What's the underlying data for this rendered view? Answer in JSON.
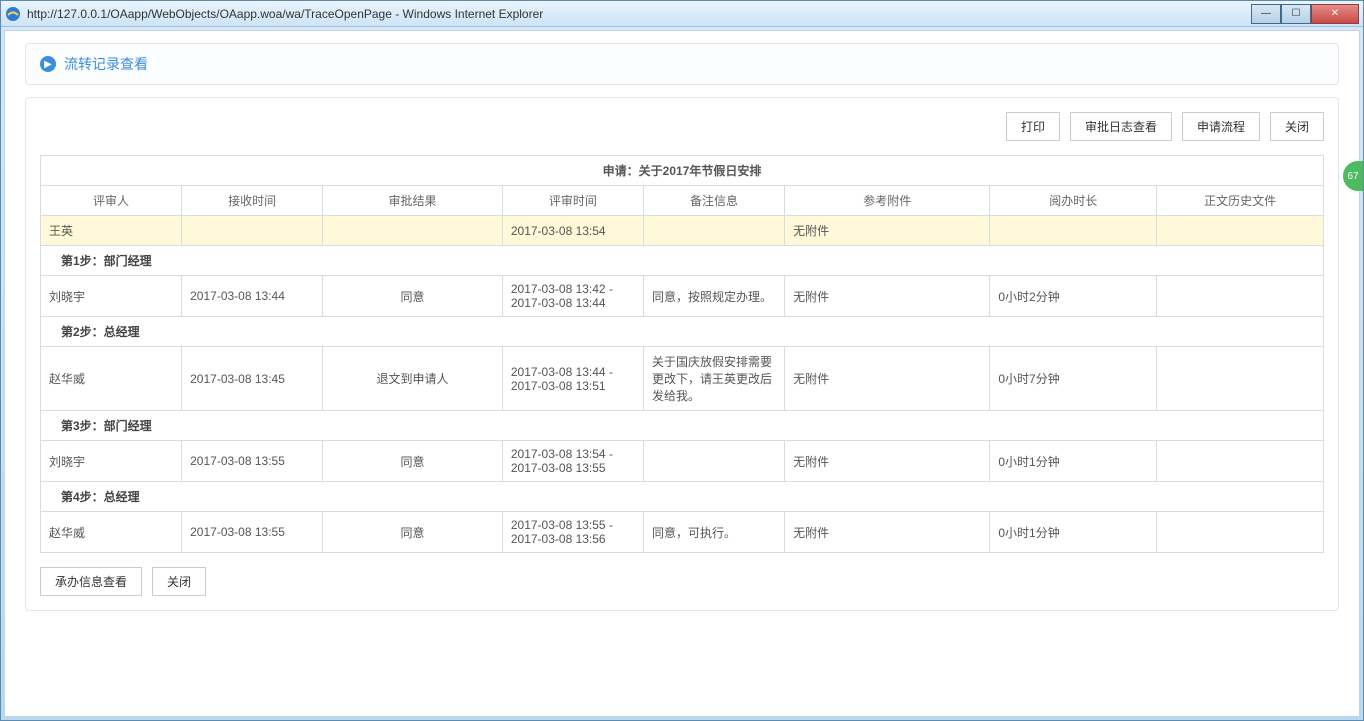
{
  "window": {
    "title": "http://127.0.0.1/OAapp/WebObjects/OAapp.woa/wa/TraceOpenPage - Windows Internet Explorer"
  },
  "header": {
    "title": "流转记录查看"
  },
  "toolbar": {
    "print": "打印",
    "audit_log": "审批日志查看",
    "request_flow": "申请流程",
    "close": "关闭"
  },
  "table": {
    "caption": "申请：关于2017年节假日安排",
    "headers": {
      "reviewer": "评审人",
      "receive_time": "接收时间",
      "audit_result": "审批结果",
      "review_time": "评审时间",
      "remarks": "备注信息",
      "attachments": "参考附件",
      "read_duration": "阅办时长",
      "history_file": "正文历史文件"
    },
    "highlight": {
      "reviewer": "王英",
      "receive_time": "",
      "audit_result": "",
      "review_time": "2017-03-08 13:54",
      "remarks": "",
      "attachments": "无附件",
      "read_duration": "",
      "history_file": ""
    },
    "steps": [
      {
        "label": "第1步：部门经理",
        "rows": [
          {
            "reviewer": "刘晓宇",
            "receive_time": "2017-03-08 13:44",
            "audit_result": "同意",
            "review_time": "2017-03-08 13:42 - 2017-03-08 13:44",
            "remarks": "同意，按照规定办理。",
            "attachments": "无附件",
            "read_duration": "0小时2分钟",
            "history_file": ""
          }
        ]
      },
      {
        "label": "第2步：总经理",
        "rows": [
          {
            "reviewer": "赵华威",
            "receive_time": "2017-03-08 13:45",
            "audit_result": "退文到申请人",
            "review_time": "2017-03-08 13:44 - 2017-03-08 13:51",
            "remarks": "关于国庆放假安排需要更改下，请王英更改后发给我。",
            "attachments": "无附件",
            "read_duration": "0小时7分钟",
            "history_file": ""
          }
        ]
      },
      {
        "label": "第3步：部门经理",
        "rows": [
          {
            "reviewer": "刘晓宇",
            "receive_time": "2017-03-08 13:55",
            "audit_result": "同意",
            "review_time": "2017-03-08 13:54 - 2017-03-08 13:55",
            "remarks": "",
            "attachments": "无附件",
            "read_duration": "0小时1分钟",
            "history_file": ""
          }
        ]
      },
      {
        "label": "第4步：总经理",
        "rows": [
          {
            "reviewer": "赵华威",
            "receive_time": "2017-03-08 13:55",
            "audit_result": "同意",
            "review_time": "2017-03-08 13:55 - 2017-03-08 13:56",
            "remarks": "同意，可执行。",
            "attachments": "无附件",
            "read_duration": "0小时1分钟",
            "history_file": ""
          }
        ]
      }
    ]
  },
  "bottom_toolbar": {
    "handle_info": "承办信息查看",
    "close": "关闭"
  },
  "badge": "67"
}
